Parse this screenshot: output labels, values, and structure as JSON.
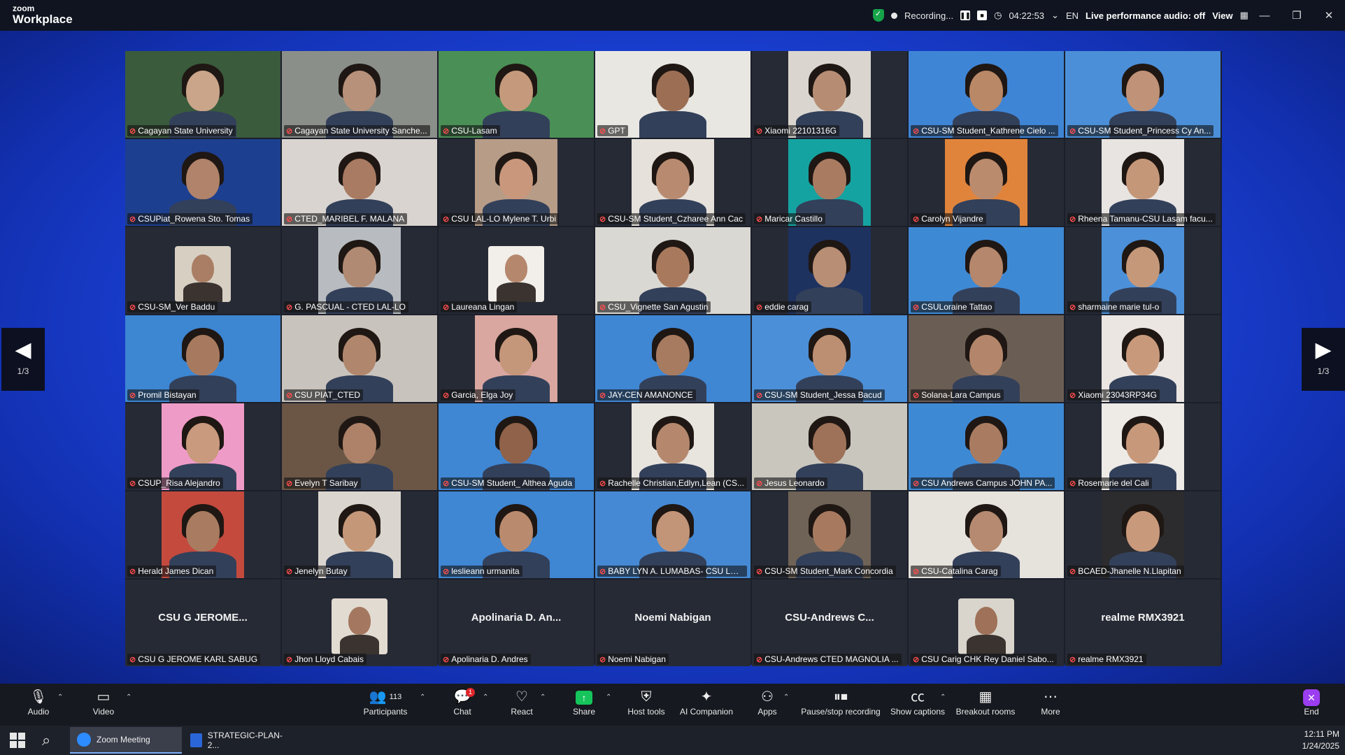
{
  "app": {
    "brand_line1": "zoom",
    "brand_line2": "Workplace"
  },
  "top_status": {
    "recording_label": "Recording...",
    "timer": "04:22:53",
    "language": "EN",
    "audio": "Live performance audio: off",
    "view_label": "View"
  },
  "window_controls": {
    "minimize": "—",
    "restore": "❐",
    "close": "✕"
  },
  "pager": {
    "left": "1/3",
    "right": "1/3"
  },
  "participants": [
    {
      "name": "Cagayan State University",
      "video": true,
      "bg": "#3a5b3c",
      "skin": "#caa58a",
      "active": true
    },
    {
      "name": "Cagayan State University Sanche...",
      "video": true,
      "bg": "#8b8f8a",
      "skin": "#b8917a"
    },
    {
      "name": "CSU-Lasam",
      "video": true,
      "bg": "#4a8f55",
      "skin": "#c59a7c"
    },
    {
      "name": "GPT",
      "video": true,
      "bg": "#e9e7e2",
      "skin": "#9c6f55"
    },
    {
      "name": "Xiaomi 22101316G",
      "video": true,
      "bg": "#dad6cf",
      "skin": "#b68d73",
      "narrow": true
    },
    {
      "name": "CSU-SM Student_Kathrene Cielo ...",
      "video": true,
      "bg": "#3f85d6",
      "skin": "#b98867"
    },
    {
      "name": "CSU-SM Student_Princess Cy An...",
      "video": true,
      "bg": "#4b8fd8",
      "skin": "#c09277"
    },
    {
      "name": "CSUPiat_Rowena Sto. Tomas",
      "video": true,
      "bg": "#1d3f8f",
      "skin": "#b0836a"
    },
    {
      "name": "CTED_MARIBEL F. MALANA",
      "video": true,
      "bg": "#d9d4cf",
      "skin": "#a97b62"
    },
    {
      "name": "CSU LAL-LO Mylene T. Urbi",
      "video": true,
      "bg": "#b79c87",
      "skin": "#c9977c",
      "narrow": true
    },
    {
      "name": "CSU-SM Student_Czharee Ann Cac",
      "video": true,
      "bg": "#e6e1da",
      "skin": "#b88b70",
      "narrow": true
    },
    {
      "name": "Maricar Castillo",
      "video": true,
      "bg": "#15a3a1",
      "skin": "#a97c62",
      "narrow": true
    },
    {
      "name": "Carolyn Vijandre",
      "video": true,
      "bg": "#e0843c",
      "skin": "#bb8b6d",
      "narrow": true
    },
    {
      "name": "Rheena Tamanu-CSU Lasam facu...",
      "video": true,
      "bg": "#e7e4e1",
      "skin": "#c59779",
      "narrow": true
    },
    {
      "name": "CSU-SM_Ver Baddu",
      "video": false,
      "avatar": true,
      "bg": "#d7cfc2",
      "skin": "#a97e64"
    },
    {
      "name": "G. PASCUAL - CTED LAL-LO",
      "video": true,
      "bg": "#b8bcc0",
      "skin": "#b08a72",
      "narrow": true
    },
    {
      "name": "Laureana Lingan",
      "video": false,
      "avatar": true,
      "bg": "#f2eee9",
      "skin": "#b5876d"
    },
    {
      "name": "CSU_Vignette San Agustin",
      "video": true,
      "bg": "#dad8d2",
      "skin": "#a9795e"
    },
    {
      "name": "eddie carag",
      "video": true,
      "bg": "#1e3260",
      "skin": "#b88e74",
      "narrow": true
    },
    {
      "name": "CSULoraine Tattao",
      "video": true,
      "bg": "#3e89d4",
      "skin": "#b5876c"
    },
    {
      "name": "sharmaine marie tul-o",
      "video": true,
      "bg": "#4c90d9",
      "skin": "#c5987a",
      "narrow": true
    },
    {
      "name": "Promil Bistayan",
      "video": true,
      "bg": "#3d86d2",
      "skin": "#a77a5f"
    },
    {
      "name": "CSU PIAT_CTED",
      "video": true,
      "bg": "#c9c3bd",
      "skin": "#b0876d"
    },
    {
      "name": "Garcia, Elga Joy",
      "video": true,
      "bg": "#d9a7a0",
      "skin": "#c4967a",
      "narrow": true
    },
    {
      "name": "JAY-CEN AMANONCE",
      "video": true,
      "bg": "#3f86d3",
      "skin": "#a77b60"
    },
    {
      "name": "CSU-SM Student_Jessa Bacud",
      "video": true,
      "bg": "#4b8fd8",
      "skin": "#bd8f72"
    },
    {
      "name": "Solana-Lara Campus",
      "video": true,
      "bg": "#6a5d54",
      "skin": "#b3866b"
    },
    {
      "name": "Xiaomi 23043RP34G",
      "video": true,
      "bg": "#ebe6e2",
      "skin": "#c9997b",
      "narrow": true
    },
    {
      "name": "CSUP_Risa Alejandro",
      "video": true,
      "bg": "#ef9bc7",
      "skin": "#c99a7d",
      "narrow": true
    },
    {
      "name": "Evelyn T Saribay",
      "video": true,
      "bg": "#6b5646",
      "skin": "#ad8268"
    },
    {
      "name": "CSU-SM Student_ Althea Aguda",
      "video": true,
      "bg": "#3f86d3",
      "skin": "#8f6249"
    },
    {
      "name": "Rachelle Christian,Edlyn,Lean (CS...",
      "video": true,
      "bg": "#e8e4de",
      "skin": "#b5886d",
      "narrow": true
    },
    {
      "name": "Jesus Leonardo",
      "video": true,
      "bg": "#c9c6be",
      "skin": "#9e7258"
    },
    {
      "name": "CSU Andrews Campus JOHN PA...",
      "video": true,
      "bg": "#3e89d4",
      "skin": "#a97c61"
    },
    {
      "name": "Rosemarie del Cali",
      "video": true,
      "bg": "#eeeae6",
      "skin": "#c7987a",
      "narrow": true
    },
    {
      "name": "Herald James Dican",
      "video": true,
      "bg": "#c44a3e",
      "skin": "#a97b60",
      "narrow": true
    },
    {
      "name": "Jenelyn Butay",
      "video": true,
      "bg": "#dad6cf",
      "skin": "#c59779",
      "narrow": true
    },
    {
      "name": "leslieann urmanita",
      "video": true,
      "bg": "#3f86d3",
      "skin": "#b98a6e"
    },
    {
      "name": "BABY LYN A. LUMABAS- CSU LAL...",
      "video": true,
      "bg": "#4589d4",
      "skin": "#c29478"
    },
    {
      "name": "CSU-SM Student_Mark Concordia",
      "video": true,
      "bg": "#6f6357",
      "skin": "#a77a60",
      "narrow": true
    },
    {
      "name": "CSU-Catalina Carag",
      "video": true,
      "bg": "#e6e2dc",
      "skin": "#b58a70"
    },
    {
      "name": "BCAED-Jhanelle N.Llapitan",
      "video": true,
      "bg": "#2c2b2d",
      "skin": "#c9997b",
      "narrow": true
    },
    {
      "name": "CSU G JEROME KARL SABUG",
      "video": false,
      "display": "CSU G JEROME..."
    },
    {
      "name": "Jhon Lloyd Cabais",
      "video": false,
      "avatar": true,
      "bg": "#e2dbd1",
      "skin": "#a47860"
    },
    {
      "name": "Apolinaria D. Andres",
      "video": false,
      "display": "Apolinaria D. An..."
    },
    {
      "name": "Noemi Nabigan",
      "video": false,
      "display": "Noemi Nabigan"
    },
    {
      "name": "CSU-Andrews CTED MAGNOLIA ...",
      "video": false,
      "display": "CSU-Andrews C..."
    },
    {
      "name": "CSU Carig CHK Rey Daniel Sabo...",
      "video": false,
      "avatar": true,
      "bg": "#d9d5cc",
      "skin": "#9e7158"
    },
    {
      "name": "realme RMX3921",
      "video": false,
      "display": "realme RMX3921"
    }
  ],
  "toolbar": {
    "audio": "Audio",
    "video": "Video",
    "participants": "Participants",
    "participants_count": "113",
    "chat": "Chat",
    "chat_badge": "1",
    "react": "React",
    "share": "Share",
    "host_tools": "Host tools",
    "ai_companion": "AI Companion",
    "apps": "Apps",
    "pause_stop": "Pause/stop recording",
    "captions": "Show captions",
    "breakout": "Breakout rooms",
    "more": "More",
    "end": "End"
  },
  "taskbar": {
    "app1": "Zoom Meeting",
    "app2": "STRATEGIC-PLAN-2...",
    "time": "12:11 PM",
    "date": "1/24/2025"
  }
}
